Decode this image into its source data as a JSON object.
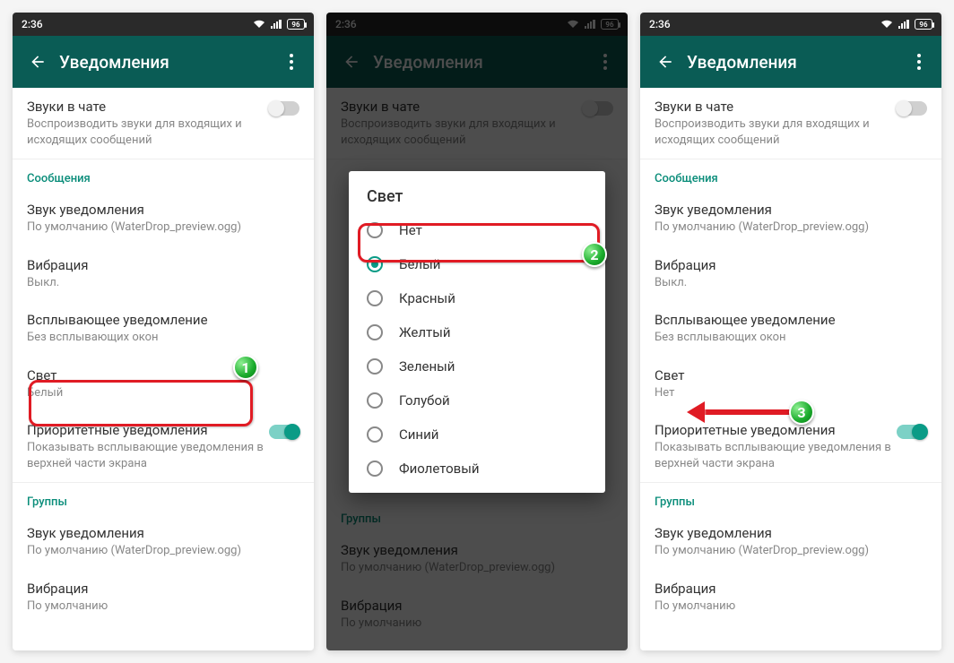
{
  "status": {
    "time": "2:36",
    "battery": "96"
  },
  "app": {
    "title": "Уведомления"
  },
  "chat_sounds": {
    "title": "Звуки в чате",
    "sub": "Воспроизводить звуки для входящих и исходящих сообщений"
  },
  "sections": {
    "messages_label": "Сообщения",
    "groups_label": "Группы"
  },
  "items": {
    "notif_sound_title": "Звук уведомления",
    "notif_sound_sub": "По умолчанию (WaterDrop_preview.ogg)",
    "vibration_title": "Вибрация",
    "vibration_off": "Выкл.",
    "vibration_default": "По умолчанию",
    "popup_title": "Всплывающее уведомление",
    "popup_sub": "Без всплывающих окон",
    "light_title": "Свет",
    "light_value_white": "Белый",
    "light_value_none": "Нет",
    "priority_title": "Приоритетные уведомления",
    "priority_sub": "Показывать всплывающие уведомления в верхней части экрана"
  },
  "dialog": {
    "title": "Свет",
    "options": [
      "Нет",
      "Белый",
      "Красный",
      "Желтый",
      "Зеленый",
      "Голубой",
      "Синий",
      "Фиолетовый"
    ],
    "checked_index": 1
  },
  "badges": {
    "one": "1",
    "two": "2",
    "three": "3"
  }
}
